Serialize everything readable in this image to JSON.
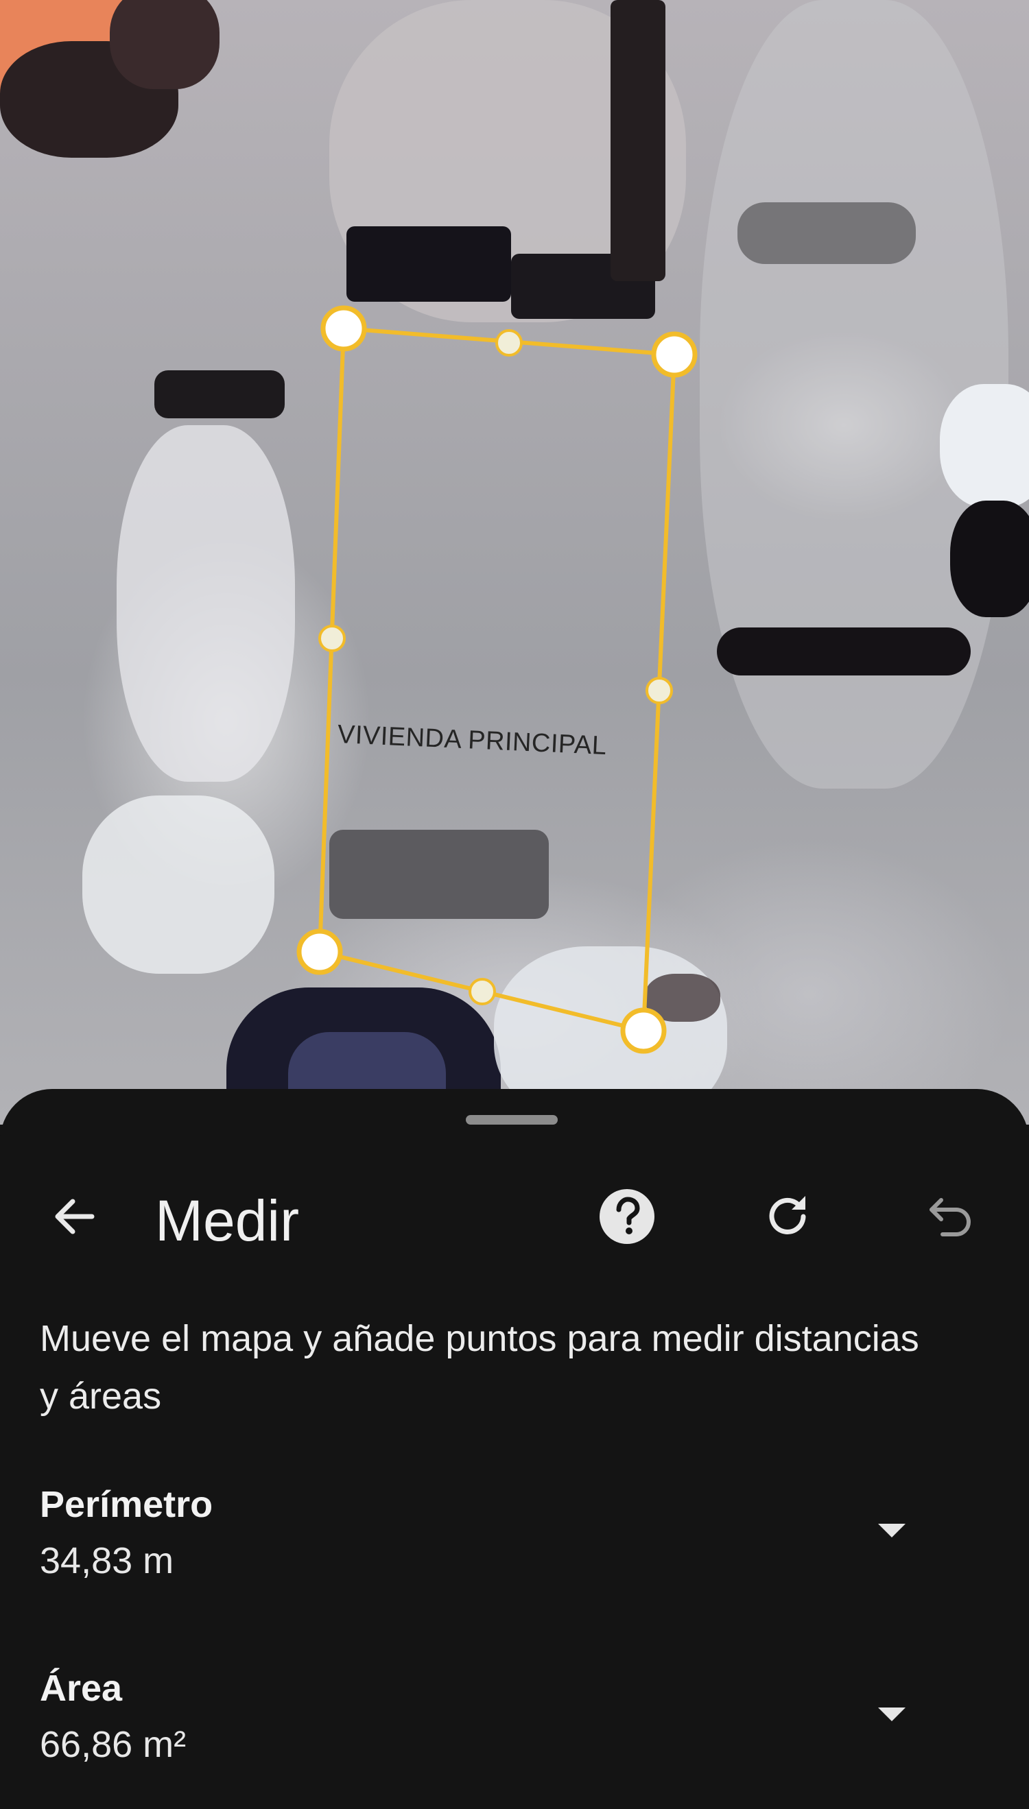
{
  "map": {
    "polygon_label": "VIVIENDA PRINCIPAL",
    "outline_color": "#f2bc2a"
  },
  "sheet": {
    "title": "Medir",
    "back_icon": "arrow-left-icon",
    "help_icon": "help-circle-icon",
    "refresh_icon": "refresh-icon",
    "undo_icon": "undo-icon",
    "instructions": "Mueve el mapa y añade puntos para medir distancias y áreas",
    "perimeter": {
      "label": "Perímetro",
      "value": "34,83 m",
      "expand_icon": "triangle-down-icon"
    },
    "area": {
      "label": "Área",
      "value": "66,86 m²",
      "expand_icon": "triangle-down-icon"
    }
  }
}
